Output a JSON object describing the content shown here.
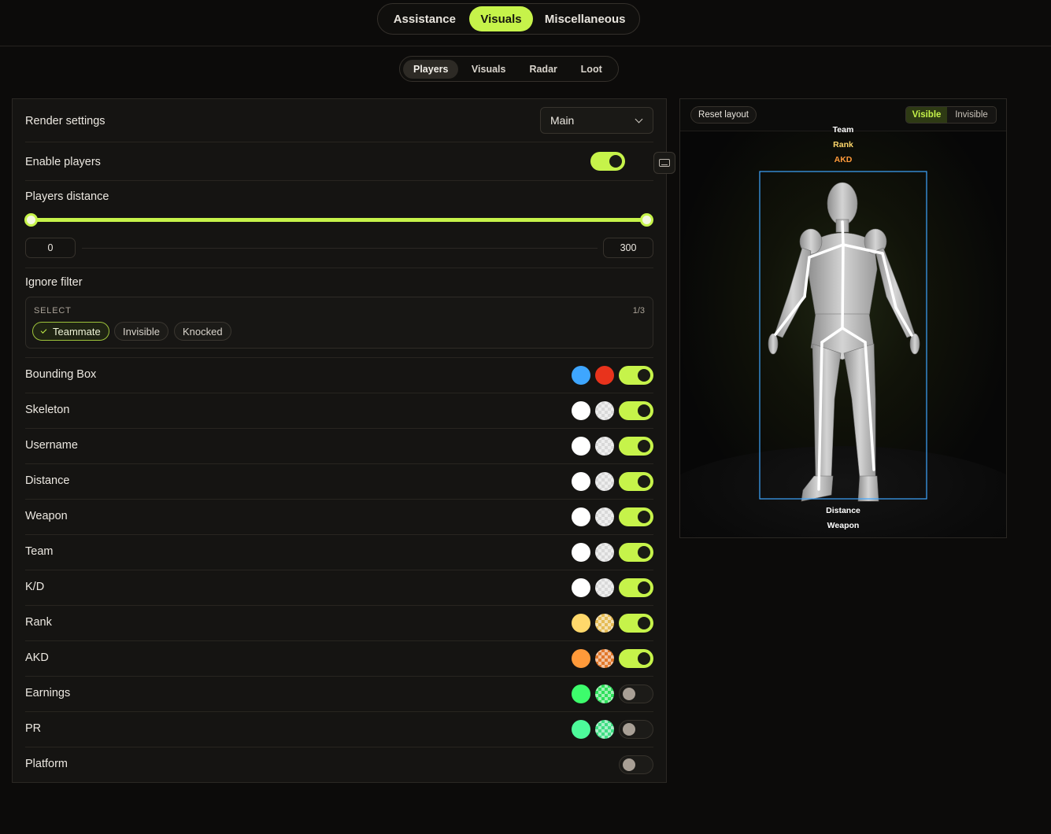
{
  "main_tabs": [
    {
      "label": "Assistance"
    },
    {
      "label": "Visuals"
    },
    {
      "label": "Miscellaneous"
    }
  ],
  "sub_tabs": [
    {
      "label": "Players"
    },
    {
      "label": "Visuals"
    },
    {
      "label": "Radar"
    },
    {
      "label": "Loot"
    }
  ],
  "settings": {
    "render_settings": {
      "label": "Render settings",
      "value": "Main"
    },
    "enable_players": {
      "label": "Enable players",
      "enabled": true,
      "keybind_icon": "keyboard-icon"
    },
    "players_distance": {
      "label": "Players distance",
      "min": "0",
      "max": "300"
    },
    "ignore_filter": {
      "label": "Ignore filter",
      "caption": "SELECT",
      "count": "1/3",
      "options": [
        {
          "label": "Teammate",
          "selected": true
        },
        {
          "label": "Invisible",
          "selected": false
        },
        {
          "label": "Knocked",
          "selected": false
        }
      ]
    },
    "rows": [
      {
        "label": "Bounding Box",
        "visible_color": "#3ea6ff",
        "invisible_color": "#e8331c",
        "enabled": true
      },
      {
        "label": "Skeleton",
        "visible_color": "#ffffff",
        "invisible_color": "#d9d9d9",
        "enabled": true
      },
      {
        "label": "Username",
        "visible_color": "#ffffff",
        "invisible_color": "#d9d9d9",
        "enabled": true
      },
      {
        "label": "Distance",
        "visible_color": "#ffffff",
        "invisible_color": "#d9d9d9",
        "enabled": true
      },
      {
        "label": "Weapon",
        "visible_color": "#ffffff",
        "invisible_color": "#d9d9d9",
        "enabled": true
      },
      {
        "label": "Team",
        "visible_color": "#ffffff",
        "invisible_color": "#d9d9d9",
        "enabled": true
      },
      {
        "label": "K/D",
        "visible_color": "#ffffff",
        "invisible_color": "#d9d9d9",
        "enabled": true
      },
      {
        "label": "Rank",
        "visible_color": "#ffd86b",
        "invisible_color": "#e6bc55",
        "enabled": true
      },
      {
        "label": "AKD",
        "visible_color": "#ff9a3a",
        "invisible_color": "#e2782a",
        "enabled": true
      },
      {
        "label": "Earnings",
        "visible_color": "#3dfc6c",
        "invisible_color": "#2ee05b",
        "enabled": false
      },
      {
        "label": "PR",
        "visible_color": "#4dfa9a",
        "invisible_color": "#3fde84",
        "enabled": false
      },
      {
        "label": "Platform",
        "visible_color": null,
        "invisible_color": null,
        "enabled": false
      }
    ]
  },
  "preview": {
    "reset_label": "Reset layout",
    "visible_label": "Visible",
    "invisible_label": "Invisible",
    "top_labels": [
      {
        "text": "Team",
        "color": "#ffffff"
      },
      {
        "text": "Rank",
        "color": "#ffd86b"
      },
      {
        "text": "AKD",
        "color": "#ff9a3a"
      }
    ],
    "bottom_labels": [
      {
        "text": "Distance",
        "color": "#ffffff"
      },
      {
        "text": "Weapon",
        "color": "#ffffff"
      }
    ],
    "box_color": "#3ea6ff"
  },
  "colors": {
    "accent": "#c6f34a",
    "background": "#0c0b0a",
    "panel": "#151412"
  }
}
